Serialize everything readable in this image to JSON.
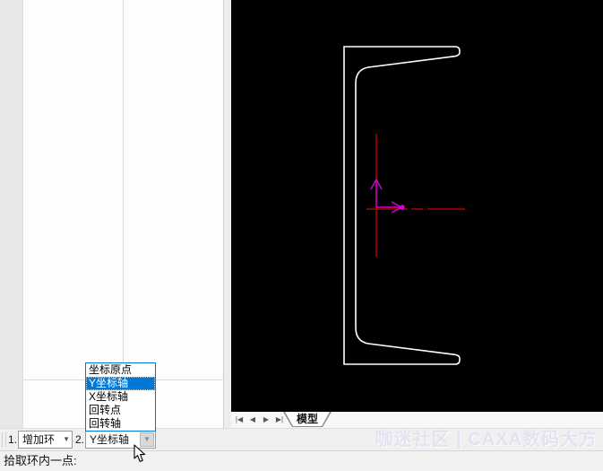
{
  "colors": {
    "outline": "#ffffff",
    "axis_red": "#d40000",
    "axis_magenta": "#d400d4",
    "selection": "#0078d7"
  },
  "canvas": {
    "tab_label": "模型",
    "nav": [
      "|◀",
      "◀",
      "▶",
      "▶|"
    ]
  },
  "dropdown": {
    "items": [
      "坐标原点",
      "Y坐标轴",
      "X坐标轴",
      "回转点",
      "回转轴"
    ],
    "selected": "Y坐标轴"
  },
  "toolbar": {
    "field1_label": "1.",
    "field1_value": "增加环",
    "field2_label": "2.",
    "field2_value": "Y坐标轴",
    "arrow_glyph": "▼"
  },
  "status": {
    "text": "拾取环内一点:"
  },
  "watermark": {
    "text": "咖迷社区 | CAXA数码大方"
  }
}
